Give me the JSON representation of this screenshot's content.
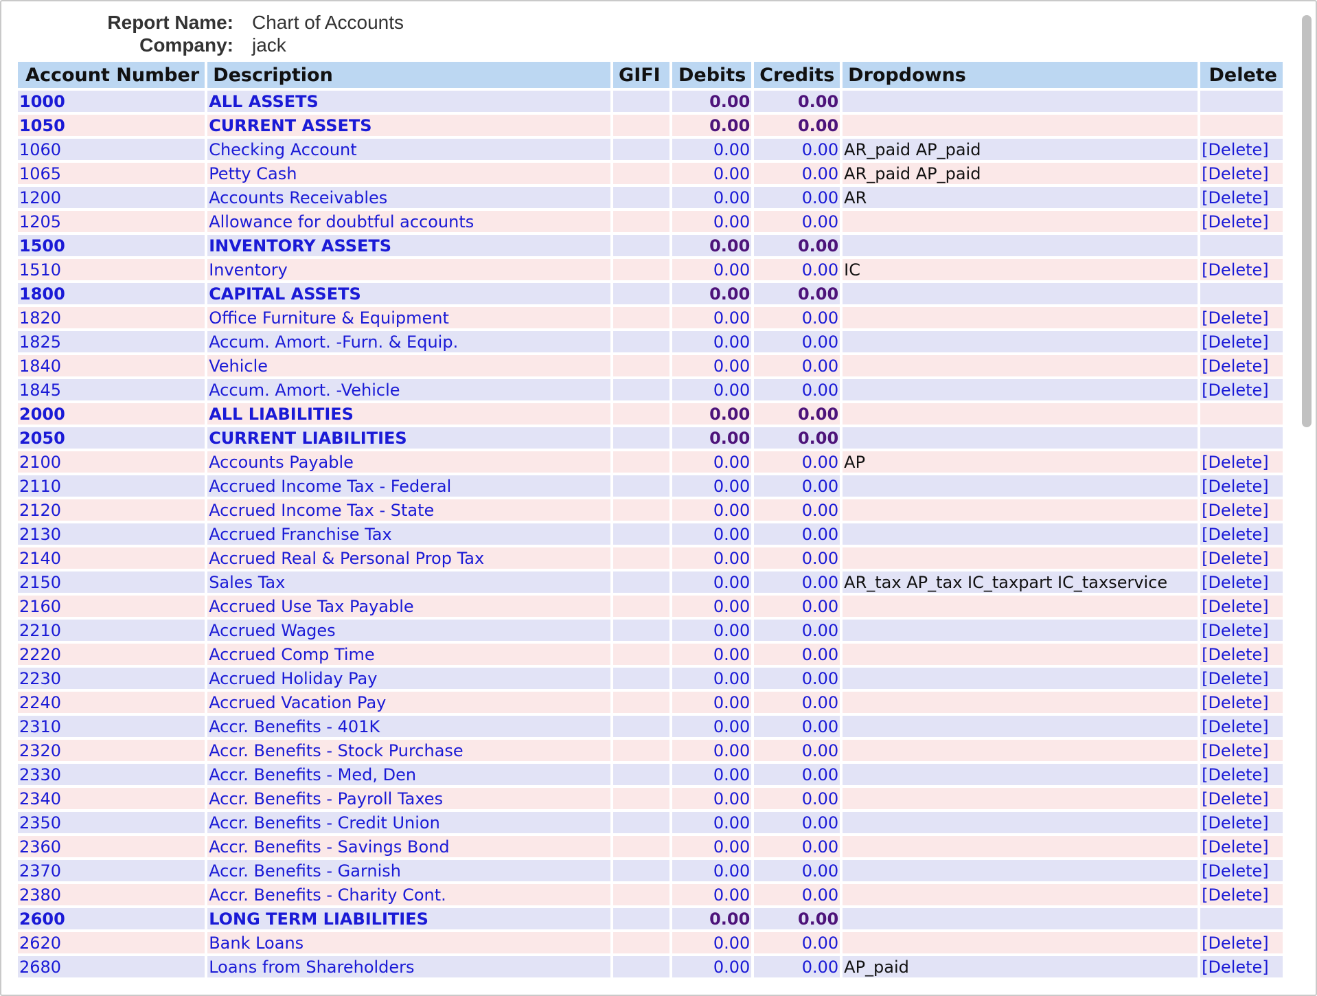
{
  "report": {
    "name_label": "Report Name:",
    "name_value": "Chart of Accounts",
    "company_label": "Company:",
    "company_value": "jack"
  },
  "columns": {
    "account_number": "Account Number",
    "description": "Description",
    "gifi": "GIFI",
    "debits": "Debits",
    "credits": "Credits",
    "dropdowns": "Dropdowns",
    "delete": "Delete"
  },
  "rows": [
    {
      "accno": "1000",
      "description": "ALL ASSETS",
      "gifi": "",
      "debits": "0.00",
      "credits": "0.00",
      "dropdowns": "",
      "delete": "",
      "heading": true
    },
    {
      "accno": "1050",
      "description": "CURRENT ASSETS",
      "gifi": "",
      "debits": "0.00",
      "credits": "0.00",
      "dropdowns": "",
      "delete": "",
      "heading": true
    },
    {
      "accno": "1060",
      "description": "Checking Account",
      "gifi": "",
      "debits": "0.00",
      "credits": "0.00",
      "dropdowns": "AR_paid AP_paid",
      "delete": "[Delete]",
      "heading": false
    },
    {
      "accno": "1065",
      "description": "Petty Cash",
      "gifi": "",
      "debits": "0.00",
      "credits": "0.00",
      "dropdowns": "AR_paid AP_paid",
      "delete": "[Delete]",
      "heading": false
    },
    {
      "accno": "1200",
      "description": "Accounts Receivables",
      "gifi": "",
      "debits": "0.00",
      "credits": "0.00",
      "dropdowns": "AR",
      "delete": "[Delete]",
      "heading": false
    },
    {
      "accno": "1205",
      "description": "Allowance for doubtful accounts",
      "gifi": "",
      "debits": "0.00",
      "credits": "0.00",
      "dropdowns": "",
      "delete": "[Delete]",
      "heading": false
    },
    {
      "accno": "1500",
      "description": "INVENTORY ASSETS",
      "gifi": "",
      "debits": "0.00",
      "credits": "0.00",
      "dropdowns": "",
      "delete": "",
      "heading": true
    },
    {
      "accno": "1510",
      "description": "Inventory",
      "gifi": "",
      "debits": "0.00",
      "credits": "0.00",
      "dropdowns": "IC",
      "delete": "[Delete]",
      "heading": false
    },
    {
      "accno": "1800",
      "description": "CAPITAL ASSETS",
      "gifi": "",
      "debits": "0.00",
      "credits": "0.00",
      "dropdowns": "",
      "delete": "",
      "heading": true
    },
    {
      "accno": "1820",
      "description": "Office Furniture & Equipment",
      "gifi": "",
      "debits": "0.00",
      "credits": "0.00",
      "dropdowns": "",
      "delete": "[Delete]",
      "heading": false
    },
    {
      "accno": "1825",
      "description": "Accum. Amort. -Furn. & Equip.",
      "gifi": "",
      "debits": "0.00",
      "credits": "0.00",
      "dropdowns": "",
      "delete": "[Delete]",
      "heading": false
    },
    {
      "accno": "1840",
      "description": "Vehicle",
      "gifi": "",
      "debits": "0.00",
      "credits": "0.00",
      "dropdowns": "",
      "delete": "[Delete]",
      "heading": false
    },
    {
      "accno": "1845",
      "description": "Accum. Amort. -Vehicle",
      "gifi": "",
      "debits": "0.00",
      "credits": "0.00",
      "dropdowns": "",
      "delete": "[Delete]",
      "heading": false
    },
    {
      "accno": "2000",
      "description": "ALL LIABILITIES",
      "gifi": "",
      "debits": "0.00",
      "credits": "0.00",
      "dropdowns": "",
      "delete": "",
      "heading": true
    },
    {
      "accno": "2050",
      "description": "CURRENT LIABILITIES",
      "gifi": "",
      "debits": "0.00",
      "credits": "0.00",
      "dropdowns": "",
      "delete": "",
      "heading": true
    },
    {
      "accno": "2100",
      "description": "Accounts Payable",
      "gifi": "",
      "debits": "0.00",
      "credits": "0.00",
      "dropdowns": "AP",
      "delete": "[Delete]",
      "heading": false
    },
    {
      "accno": "2110",
      "description": "Accrued Income Tax - Federal",
      "gifi": "",
      "debits": "0.00",
      "credits": "0.00",
      "dropdowns": "",
      "delete": "[Delete]",
      "heading": false
    },
    {
      "accno": "2120",
      "description": "Accrued Income Tax - State",
      "gifi": "",
      "debits": "0.00",
      "credits": "0.00",
      "dropdowns": "",
      "delete": "[Delete]",
      "heading": false
    },
    {
      "accno": "2130",
      "description": "Accrued Franchise Tax",
      "gifi": "",
      "debits": "0.00",
      "credits": "0.00",
      "dropdowns": "",
      "delete": "[Delete]",
      "heading": false
    },
    {
      "accno": "2140",
      "description": "Accrued Real & Personal Prop Tax",
      "gifi": "",
      "debits": "0.00",
      "credits": "0.00",
      "dropdowns": "",
      "delete": "[Delete]",
      "heading": false
    },
    {
      "accno": "2150",
      "description": "Sales Tax",
      "gifi": "",
      "debits": "0.00",
      "credits": "0.00",
      "dropdowns": "AR_tax AP_tax IC_taxpart IC_taxservice",
      "delete": "[Delete]",
      "heading": false
    },
    {
      "accno": "2160",
      "description": "Accrued Use Tax Payable",
      "gifi": "",
      "debits": "0.00",
      "credits": "0.00",
      "dropdowns": "",
      "delete": "[Delete]",
      "heading": false
    },
    {
      "accno": "2210",
      "description": "Accrued Wages",
      "gifi": "",
      "debits": "0.00",
      "credits": "0.00",
      "dropdowns": "",
      "delete": "[Delete]",
      "heading": false
    },
    {
      "accno": "2220",
      "description": "Accrued Comp Time",
      "gifi": "",
      "debits": "0.00",
      "credits": "0.00",
      "dropdowns": "",
      "delete": "[Delete]",
      "heading": false
    },
    {
      "accno": "2230",
      "description": "Accrued Holiday Pay",
      "gifi": "",
      "debits": "0.00",
      "credits": "0.00",
      "dropdowns": "",
      "delete": "[Delete]",
      "heading": false
    },
    {
      "accno": "2240",
      "description": "Accrued Vacation Pay",
      "gifi": "",
      "debits": "0.00",
      "credits": "0.00",
      "dropdowns": "",
      "delete": "[Delete]",
      "heading": false
    },
    {
      "accno": "2310",
      "description": "Accr. Benefits - 401K",
      "gifi": "",
      "debits": "0.00",
      "credits": "0.00",
      "dropdowns": "",
      "delete": "[Delete]",
      "heading": false
    },
    {
      "accno": "2320",
      "description": "Accr. Benefits - Stock Purchase",
      "gifi": "",
      "debits": "0.00",
      "credits": "0.00",
      "dropdowns": "",
      "delete": "[Delete]",
      "heading": false
    },
    {
      "accno": "2330",
      "description": "Accr. Benefits - Med, Den",
      "gifi": "",
      "debits": "0.00",
      "credits": "0.00",
      "dropdowns": "",
      "delete": "[Delete]",
      "heading": false
    },
    {
      "accno": "2340",
      "description": "Accr. Benefits - Payroll Taxes",
      "gifi": "",
      "debits": "0.00",
      "credits": "0.00",
      "dropdowns": "",
      "delete": "[Delete]",
      "heading": false
    },
    {
      "accno": "2350",
      "description": "Accr. Benefits - Credit Union",
      "gifi": "",
      "debits": "0.00",
      "credits": "0.00",
      "dropdowns": "",
      "delete": "[Delete]",
      "heading": false
    },
    {
      "accno": "2360",
      "description": "Accr. Benefits - Savings Bond",
      "gifi": "",
      "debits": "0.00",
      "credits": "0.00",
      "dropdowns": "",
      "delete": "[Delete]",
      "heading": false
    },
    {
      "accno": "2370",
      "description": "Accr. Benefits - Garnish",
      "gifi": "",
      "debits": "0.00",
      "credits": "0.00",
      "dropdowns": "",
      "delete": "[Delete]",
      "heading": false
    },
    {
      "accno": "2380",
      "description": "Accr. Benefits - Charity Cont.",
      "gifi": "",
      "debits": "0.00",
      "credits": "0.00",
      "dropdowns": "",
      "delete": "[Delete]",
      "heading": false
    },
    {
      "accno": "2600",
      "description": "LONG TERM LIABILITIES",
      "gifi": "",
      "debits": "0.00",
      "credits": "0.00",
      "dropdowns": "",
      "delete": "",
      "heading": true
    },
    {
      "accno": "2620",
      "description": "Bank Loans",
      "gifi": "",
      "debits": "0.00",
      "credits": "0.00",
      "dropdowns": "",
      "delete": "[Delete]",
      "heading": false
    },
    {
      "accno": "2680",
      "description": "Loans from Shareholders",
      "gifi": "",
      "debits": "0.00",
      "credits": "0.00",
      "dropdowns": "AP_paid",
      "delete": "[Delete]",
      "heading": false
    }
  ]
}
